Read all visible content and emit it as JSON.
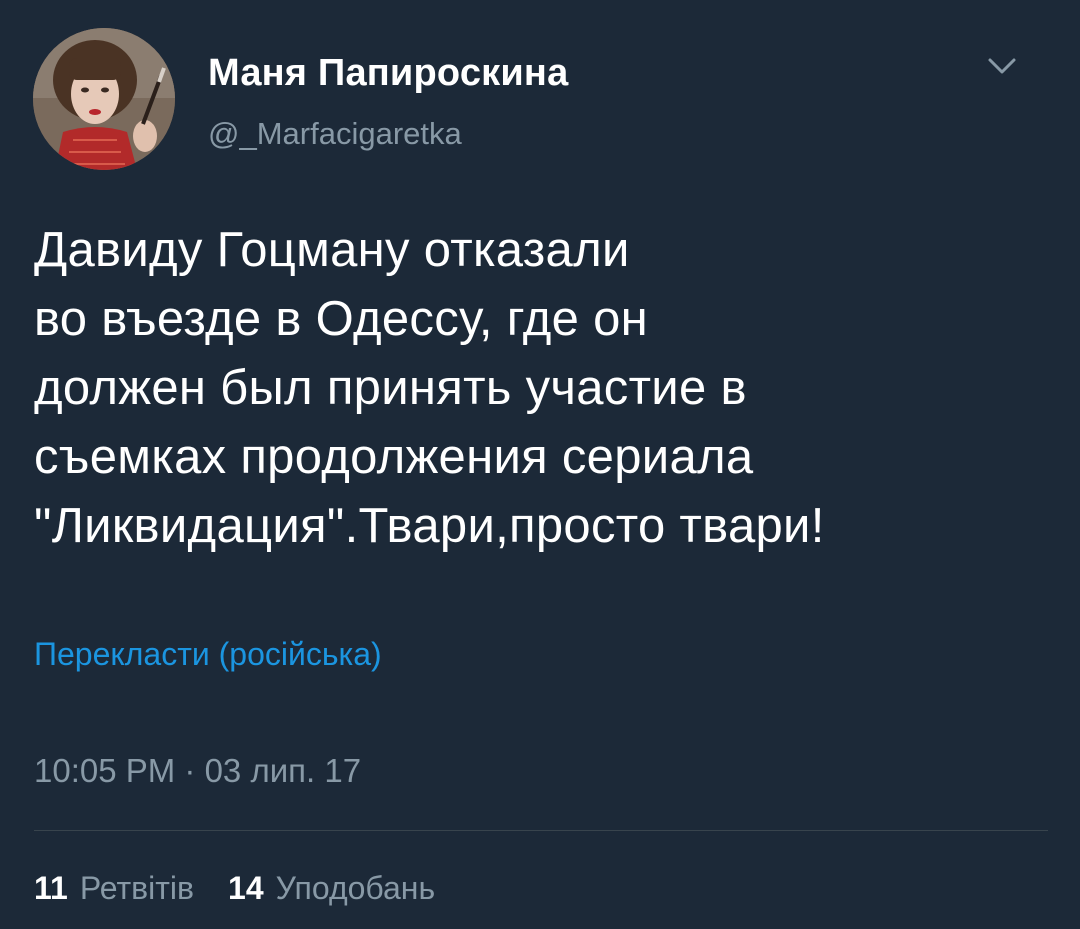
{
  "author": {
    "display_name": "Маня Папироскина",
    "handle": "@_Marfacigaretka",
    "avatar_icon": "user-avatar"
  },
  "menu": {
    "icon": "chevron-down-icon"
  },
  "tweet": {
    "text": "Давиду Гоцману отказали\nво въезде в Одессу, где он\nдолжен был принять участие в\nсъемках продолжения сериала\n\"Ликвидация\".Твари,просто твари!",
    "translate_label": "Перекласти (російська)",
    "timestamp": "10:05 PM · 03 лип. 17"
  },
  "stats": {
    "retweets_count": "11",
    "retweets_label": "Ретвітів",
    "likes_count": "14",
    "likes_label": "Уподобань"
  },
  "colors": {
    "background": "#1c2938",
    "primary_text": "#ffffff",
    "secondary_text": "#8899a6",
    "link": "#1b95e0",
    "divider": "#38444d"
  }
}
